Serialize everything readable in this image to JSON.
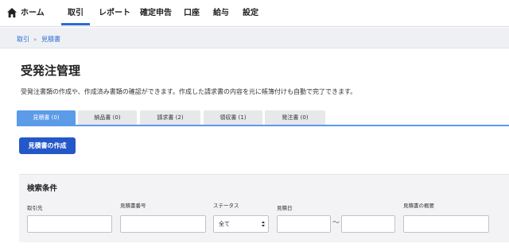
{
  "nav": {
    "items": [
      "ホーム",
      "取引",
      "レポート",
      "確定申告",
      "口座",
      "給与",
      "設定"
    ],
    "active_index": 1,
    "accent_color": "#2a6ad6"
  },
  "breadcrumb": {
    "items": [
      "取引",
      "見積書"
    ],
    "separator": "»"
  },
  "page": {
    "title": "受発注管理",
    "description": "受発注書類の作成や、作成済み書類の確認ができます。作成した請求書の内容を元に帳簿付けも自動で完了できます。"
  },
  "tabs": [
    {
      "label": "見積書 (0)",
      "active": true
    },
    {
      "label": "納品書 (0)",
      "active": false
    },
    {
      "label": "請求書 (2)",
      "active": false
    },
    {
      "label": "領収書 (1)",
      "active": false
    },
    {
      "label": "発注書 (0)",
      "active": false
    }
  ],
  "actions": {
    "create_label": "見積書の作成",
    "button_color": "#2458c8"
  },
  "search": {
    "title": "検索条件",
    "fields": {
      "partner_label": "取引先",
      "partner_value": "",
      "number_label": "見積書番号",
      "number_value": "",
      "status_label": "ステータス",
      "status_value": "全て",
      "date_label": "見積日",
      "date_from": "",
      "date_to": "",
      "date_separator": "〜",
      "summary_label": "見積書の概要",
      "summary_value": ""
    }
  },
  "icons": {
    "home": "home-icon",
    "select": "chevron-updown-icon"
  }
}
